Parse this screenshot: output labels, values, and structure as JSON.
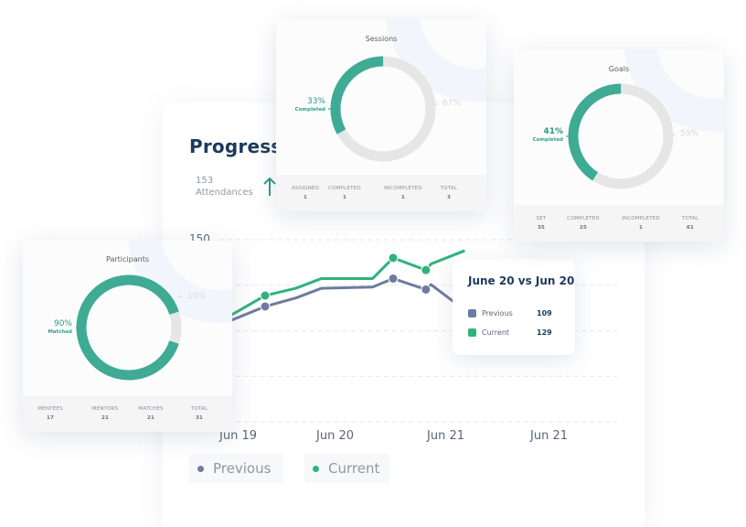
{
  "progress": {
    "title": "Progress",
    "attendance_count": "153",
    "attendance_label": "Attendances",
    "trend_icon": "arrow-up-icon",
    "y_tick_top": "150",
    "x_labels": [
      "Jun 19",
      "Jun 20",
      "Jun 21",
      "Jun 21"
    ],
    "legend": [
      {
        "label": "Previous",
        "color": "#6e7ba0"
      },
      {
        "label": "Current",
        "color": "#2fb37b"
      }
    ]
  },
  "tooltip": {
    "title": "June 20 vs Jun 20",
    "rows": [
      {
        "label": "Previous",
        "value": "109",
        "color": "#6e7ba0"
      },
      {
        "label": "Current",
        "value": "129",
        "color": "#2fb37b"
      }
    ]
  },
  "sessions": {
    "title": "Sessions",
    "completed_pct": "33%",
    "completed_label": "Completed",
    "rest_pct": "67%",
    "completed_fraction": 0.33,
    "footer": [
      {
        "label": "ASSIGNED",
        "value": "1"
      },
      {
        "label": "COMPLETED",
        "value": "1"
      },
      {
        "label": "INCOMPLETED",
        "value": "1"
      },
      {
        "label": "TOTAL",
        "value": "3"
      }
    ]
  },
  "goals": {
    "title": "Goals",
    "completed_pct": "41%",
    "completed_label": "Completed",
    "rest_pct": "59%",
    "completed_fraction": 0.41,
    "footer": [
      {
        "label": "SET",
        "value": "35"
      },
      {
        "label": "COMPLETED",
        "value": "25"
      },
      {
        "label": "INCOMPLETED",
        "value": "1"
      },
      {
        "label": "TOTAL",
        "value": "61"
      }
    ]
  },
  "participants": {
    "title": "Participants",
    "matched_pct": "90%",
    "matched_label": "Matched",
    "rest_pct": "10%",
    "matched_fraction": 0.9,
    "footer": [
      {
        "label": "MENTEES",
        "value": "17"
      },
      {
        "label": "MENTORS",
        "value": "21"
      },
      {
        "label": "MATCHES",
        "value": "21"
      },
      {
        "label": "TOTAL",
        "value": "31"
      }
    ]
  },
  "chart_data": {
    "type": "line",
    "title": "Progress",
    "x": [
      "Jun 19",
      "Jun 20",
      "Jun 21",
      "Jun 21"
    ],
    "ylim": [
      0,
      150
    ],
    "y_ticks_visible": [
      "150"
    ],
    "grid": true,
    "legend_position": "bottom-left",
    "series": [
      {
        "name": "Previous",
        "color": "#6e7ba0",
        "points": [
          [
            -0.4,
            55
          ],
          [
            -0.1,
            83
          ],
          [
            0.25,
            95
          ],
          [
            0.55,
            102
          ],
          [
            0.8,
            110
          ],
          [
            1.3,
            111
          ],
          [
            1.5,
            118
          ],
          [
            1.82,
            109
          ],
          [
            1.87,
            113
          ],
          [
            2.2,
            92
          ]
        ]
      },
      {
        "name": "Current",
        "color": "#2fb37b",
        "points": [
          [
            -0.4,
            97
          ],
          [
            -0.1,
            87
          ],
          [
            0.25,
            104
          ],
          [
            0.55,
            110
          ],
          [
            0.8,
            118
          ],
          [
            1.3,
            118
          ],
          [
            1.5,
            135
          ],
          [
            1.82,
            125
          ],
          [
            1.87,
            130
          ],
          [
            2.2,
            141
          ]
        ]
      }
    ]
  }
}
